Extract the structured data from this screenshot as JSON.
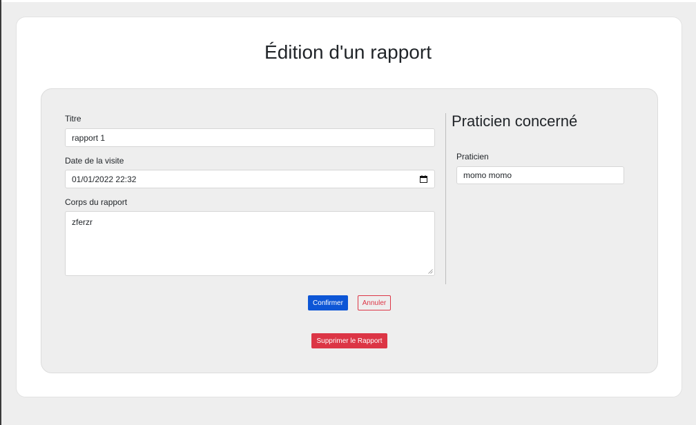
{
  "page": {
    "title": "Édition d'un rapport"
  },
  "form": {
    "titre": {
      "label": "Titre",
      "value": "rapport 1"
    },
    "date": {
      "label": "Date de la visite",
      "value": "01/01/2022 22:32"
    },
    "corps": {
      "label": "Corps du rapport",
      "value": "zferzr"
    }
  },
  "praticien_section": {
    "title": "Praticien concerné",
    "label": "Praticien",
    "value": "momo momo"
  },
  "actions": {
    "confirm": "Confirmer",
    "cancel": "Annuler",
    "delete": "Supprimer le Rapport"
  },
  "colors": {
    "primary": "#0d56d6",
    "danger": "#dc3545",
    "background": "#eeeeee"
  },
  "icons": {
    "date_picker": "calendar-icon"
  }
}
